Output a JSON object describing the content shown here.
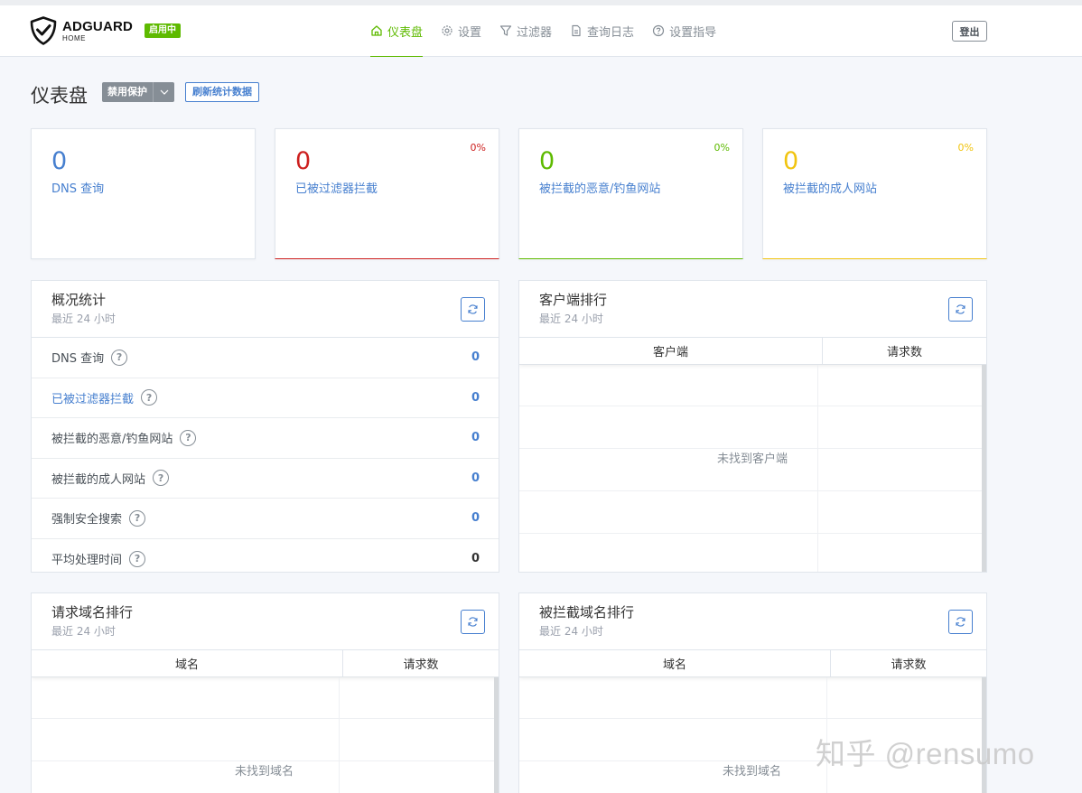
{
  "header": {
    "logo_main": "ADGUARD",
    "logo_sub": "HOME",
    "status_badge": "启用中",
    "nav": [
      {
        "label": "仪表盘",
        "icon": "home-icon",
        "active": true
      },
      {
        "label": "设置",
        "icon": "gear-icon",
        "active": false
      },
      {
        "label": "过滤器",
        "icon": "filter-icon",
        "active": false
      },
      {
        "label": "查询日志",
        "icon": "document-icon",
        "active": false
      },
      {
        "label": "设置指导",
        "icon": "help-circle-icon",
        "active": false
      }
    ],
    "logout": "登出"
  },
  "toolbar": {
    "title": "仪表盘",
    "disable_protection": "禁用保护",
    "refresh_stats": "刷新统计数据"
  },
  "stat_cards": [
    {
      "value": "0",
      "label": "DNS 查询",
      "percent": "",
      "color": "#467fcf"
    },
    {
      "value": "0",
      "label": "已被过滤器拦截",
      "percent": "0%",
      "color": "#cd201f"
    },
    {
      "value": "0",
      "label": "被拦截的恶意/钓鱼网站",
      "percent": "0%",
      "color": "#5eba00"
    },
    {
      "value": "0",
      "label": "被拦截的成人网站",
      "percent": "0%",
      "color": "#f1c40f"
    }
  ],
  "general_stats": {
    "title": "概况统计",
    "subtitle": "最近 24 小时",
    "rows": [
      {
        "label": "DNS 查询",
        "value": "0"
      },
      {
        "label": "已被过滤器拦截",
        "value": "0"
      },
      {
        "label": "被拦截的恶意/钓鱼网站",
        "value": "0"
      },
      {
        "label": "被拦截的成人网站",
        "value": "0"
      },
      {
        "label": "强制安全搜索",
        "value": "0"
      },
      {
        "label": "平均处理时间",
        "value": "0"
      }
    ]
  },
  "top_clients": {
    "title": "客户端排行",
    "subtitle": "最近 24 小时",
    "columns": [
      "客户端",
      "请求数"
    ],
    "empty": "未找到客户端"
  },
  "top_domains": {
    "title": "请求域名排行",
    "subtitle": "最近 24 小时",
    "columns": [
      "域名",
      "请求数"
    ],
    "empty": "未找到域名"
  },
  "top_blocked": {
    "title": "被拦截域名排行",
    "subtitle": "最近 24 小时",
    "columns": [
      "域名",
      "请求数"
    ],
    "empty": "未找到域名"
  },
  "help_glyph": "?",
  "watermark": "知乎 @rensumo"
}
